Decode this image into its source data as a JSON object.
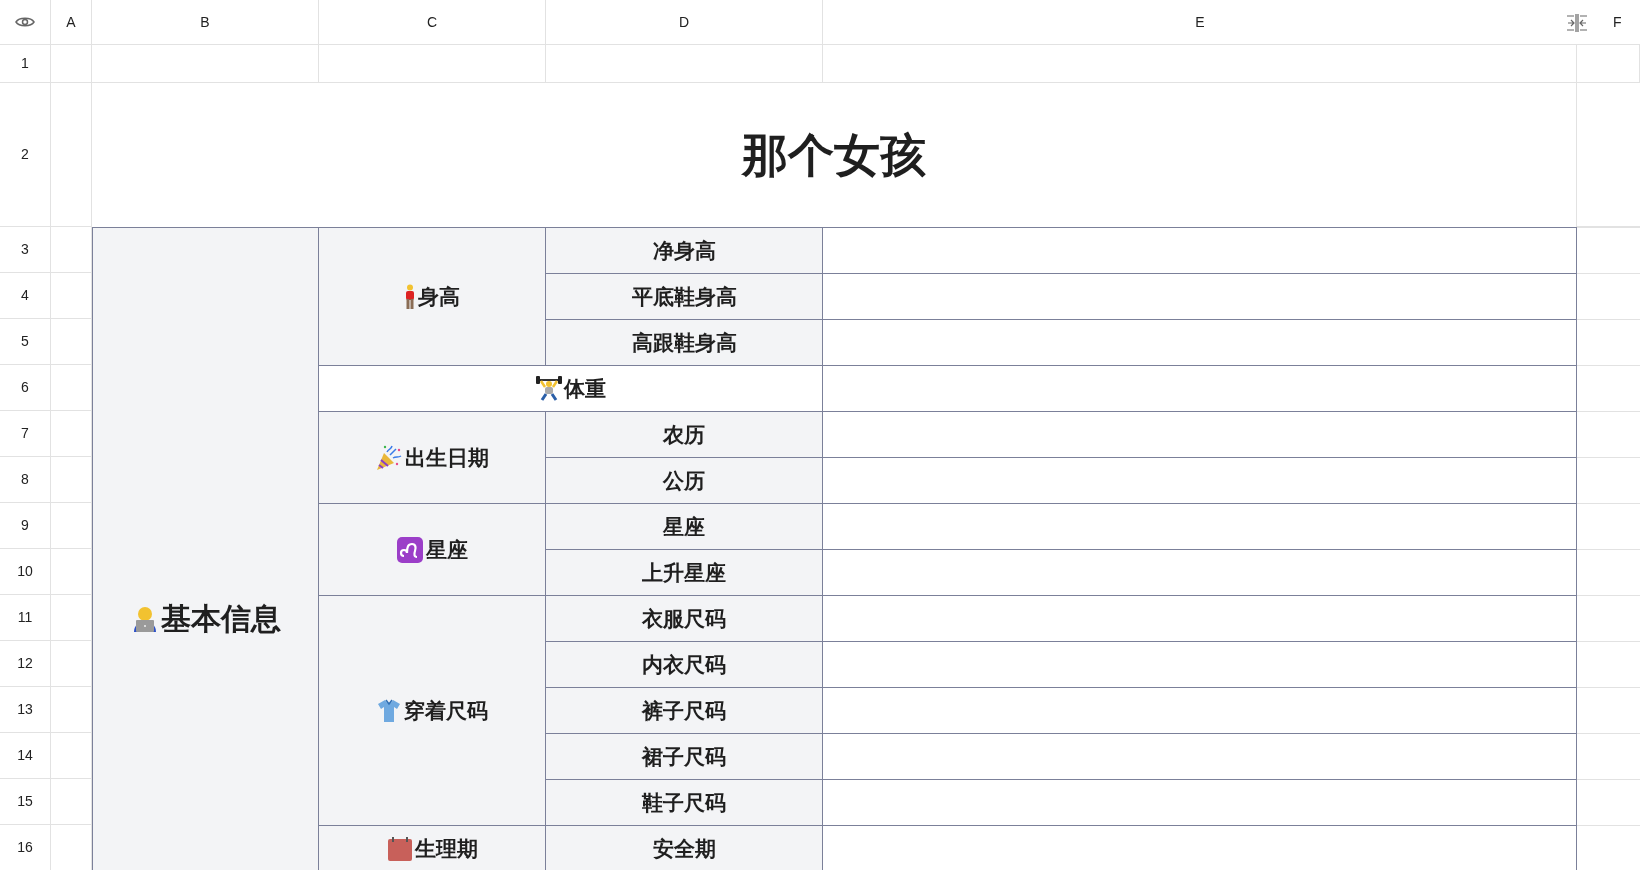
{
  "column_headers": [
    "A",
    "B",
    "C",
    "D",
    "E",
    "F"
  ],
  "row_numbers": [
    "1",
    "2",
    "3",
    "4",
    "5",
    "6",
    "7",
    "8",
    "9",
    "10",
    "11",
    "12",
    "13",
    "14",
    "15",
    "16"
  ],
  "title": "那个女孩",
  "section": {
    "label": "基本信息",
    "groups": [
      {
        "label": "身高",
        "items": [
          "净身高",
          "平底鞋身高",
          "高跟鞋身高"
        ]
      },
      {
        "label": "体重"
      },
      {
        "label": "出生日期",
        "items": [
          "农历",
          "公历"
        ]
      },
      {
        "label": "星座",
        "items": [
          "星座",
          "上升星座"
        ]
      },
      {
        "label": "穿着尺码",
        "items": [
          "衣服尺码",
          "内衣尺码",
          "裤子尺码",
          "裙子尺码",
          "鞋子尺码"
        ]
      },
      {
        "label": "生理期",
        "items": [
          "安全期"
        ]
      }
    ]
  }
}
